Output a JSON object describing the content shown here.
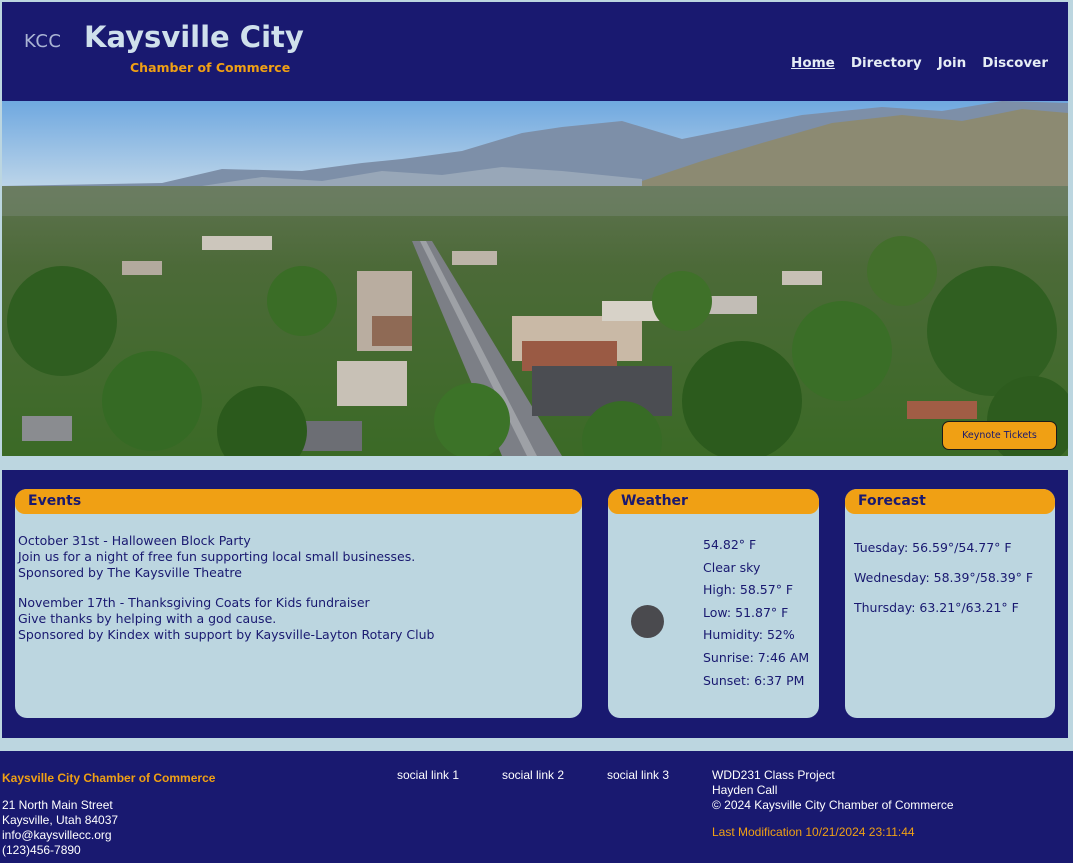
{
  "header": {
    "logo": "KCC",
    "title": "Kaysville City",
    "subtitle": "Chamber of Commerce",
    "nav": [
      "Home",
      "Directory",
      "Join",
      "Discover"
    ],
    "active_nav": "Home"
  },
  "hero": {
    "image": "aerial-view-of-kaysville",
    "button_label": "Keynote Tickets"
  },
  "events": {
    "title": "Events",
    "items": [
      {
        "date_title": "October 31st - Halloween Block Party",
        "description": "Join us for a night of free fun supporting local small businesses.",
        "sponsor": "Sponsored by The Kaysville Theatre"
      },
      {
        "date_title": "November 17th - Thanksgiving Coats for Kids fundraiser",
        "description": "Give thanks by helping with a god cause.",
        "sponsor": "Sponsored by Kindex with support by Kaysville-Layton Rotary Club"
      }
    ]
  },
  "weather": {
    "title": "Weather",
    "icon": "weather-icon",
    "temp": "54.82° F",
    "condition": "Clear sky",
    "high": "High: 58.57° F",
    "low": "Low: 51.87° F",
    "humidity": "Humidity: 52%",
    "sunrise": "Sunrise: 7:46 AM",
    "sunset": "Sunset: 6:37 PM"
  },
  "forecast": {
    "title": "Forecast",
    "days": [
      "Tuesday: 56.59°/54.77° F",
      "Wednesday: 58.39°/58.39° F",
      "Thursday: 63.21°/63.21° F"
    ]
  },
  "footer": {
    "org": "Kaysville City Chamber of Commerce",
    "address1": "21 North Main Street",
    "address2": "Kaysville, Utah 84037",
    "email": "info@kaysvillecc.org",
    "phone": "(123)456-7890",
    "social": [
      "social link 1",
      "social link 2",
      "social link 3"
    ],
    "project": "WDD231 Class Project",
    "author": "Hayden Call",
    "copyright": "© 2024 Kaysville City Chamber of Commerce",
    "last_modified": "Last Modification 10/21/2024 23:11:44"
  },
  "colors": {
    "navy": "#191970",
    "accent": "#f0a014",
    "light": "#bcd6e0"
  }
}
